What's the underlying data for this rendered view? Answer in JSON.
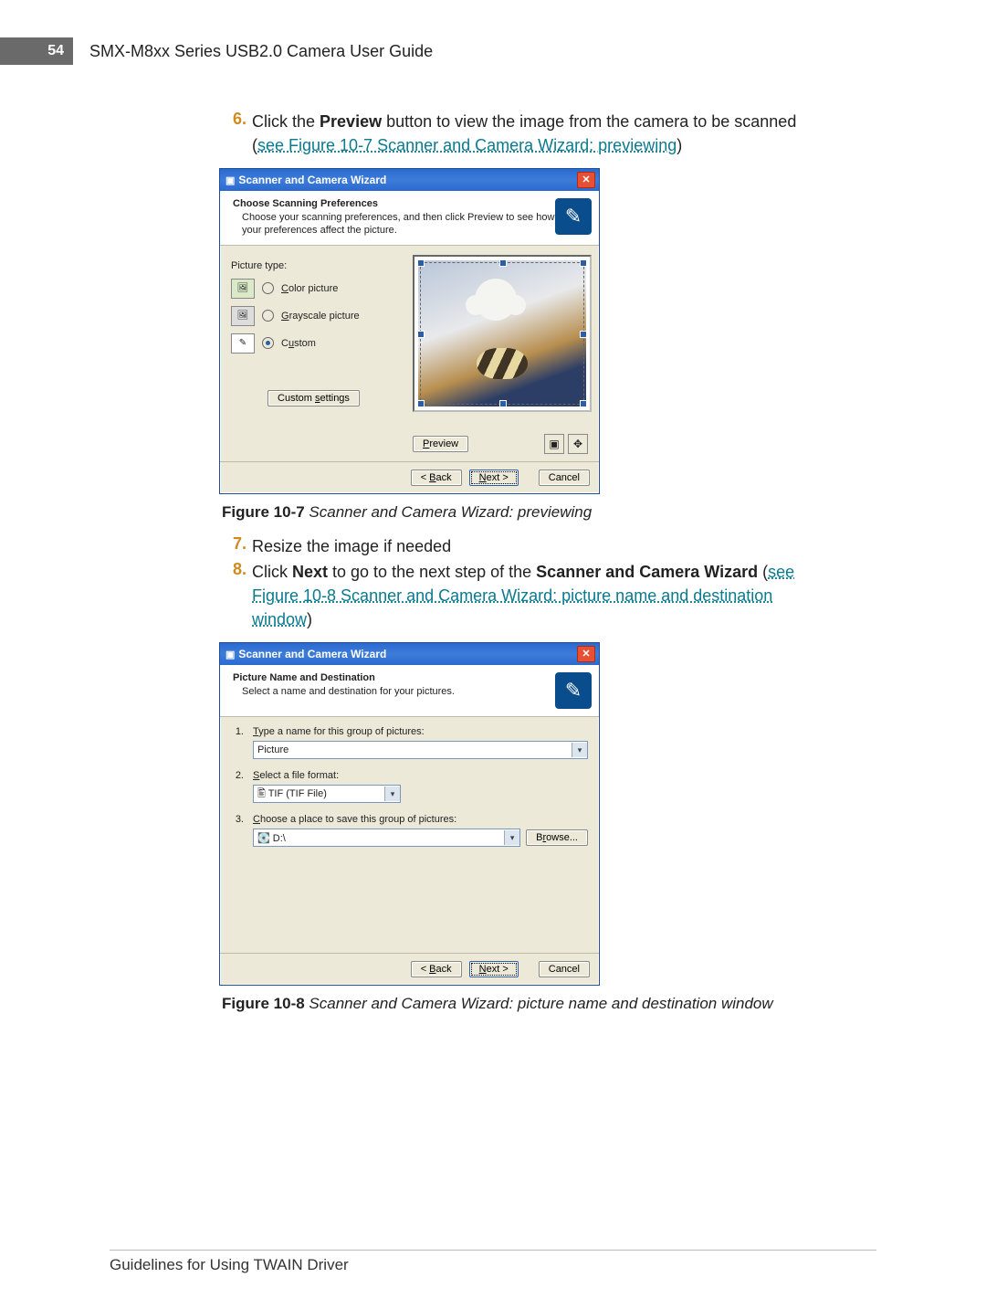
{
  "header": {
    "page_number": "54",
    "doc_title": "SMX-M8xx Series USB2.0 Camera User Guide"
  },
  "steps": {
    "s6_num": "6.",
    "s6_pre": "Click the ",
    "s6_bold": "Preview",
    "s6_post": " button to view the image from the camera to be scanned (",
    "s6_link": "see Figure 10-7 Scanner and Camera Wizard: previewing",
    "s6_close": ")",
    "s7_num": "7.",
    "s7_text": "Resize the image if needed",
    "s8_num": "8.",
    "s8_pre": "Click ",
    "s8_bold1": "Next",
    "s8_mid": " to go to the next step of the ",
    "s8_bold2": "Scanner and Camera Wizard",
    "s8_post": " (",
    "s8_link": "see Figure 10-8 Scanner and Camera Wizard: picture name and destination window",
    "s8_close": ")"
  },
  "fig1": {
    "caption_bold": "Figure 10-7",
    "caption_italic": "   Scanner and Camera Wizard: previewing",
    "title": "Scanner and Camera Wizard",
    "header_title": "Choose Scanning Preferences",
    "header_sub": "Choose your scanning preferences, and then click Preview to see how your preferences affect the picture.",
    "picture_type_label": "Picture type:",
    "opt_color": "Color picture",
    "opt_gray": "Grayscale picture",
    "opt_custom": "Custom",
    "custom_settings_btn": "Custom settings",
    "preview_btn": "Preview",
    "back_btn": "< Back",
    "next_btn": "Next >",
    "cancel_btn": "Cancel"
  },
  "fig2": {
    "caption_bold": "Figure 10-8",
    "caption_italic": "   Scanner and Camera Wizard: picture name and destination window",
    "title": "Scanner and Camera Wizard",
    "header_title": "Picture Name and Destination",
    "header_sub": "Select a name and destination for your pictures.",
    "q1_num": "1.",
    "q1_label": "Type a name for this group of pictures:",
    "q1_value": "Picture",
    "q2_num": "2.",
    "q2_label": "Select a file format:",
    "q2_value": "TIF (TIF File)",
    "q3_num": "3.",
    "q3_label": "Choose a place to save this group of pictures:",
    "q3_value": "D:\\",
    "browse_btn": "Browse...",
    "back_btn": "< Back",
    "next_btn": "Next >",
    "cancel_btn": "Cancel"
  },
  "footer": {
    "text": "Guidelines for Using TWAIN Driver"
  }
}
